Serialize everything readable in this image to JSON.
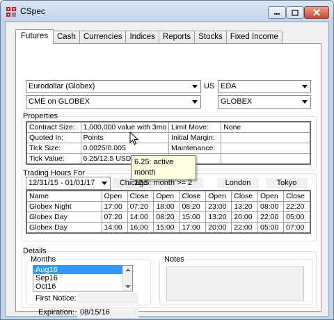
{
  "window": {
    "title": "CSpec"
  },
  "tabs": [
    "Futures",
    "Cash",
    "Currencies",
    "Indices",
    "Reports",
    "Stocks",
    "Fixed Income"
  ],
  "selectors": {
    "contract": "Eurodollar (Globex)",
    "exchange": "CME on GLOBEX",
    "country_label": "US",
    "symbol": "EDA",
    "venue": "GLOBEX"
  },
  "properties": {
    "title": "Properties",
    "rows": [
      {
        "label": "Contract Size:",
        "value": "1,000,000 value with 3mo",
        "label2": "Limit Move:",
        "value2": "None"
      },
      {
        "label": "Quoted In:",
        "value": "Points",
        "label2": "Initial Margin:",
        "value2": ""
      },
      {
        "label": "Tick Size:",
        "value": "0.0025/0.005",
        "label2": "Maintenance:",
        "value2": ""
      },
      {
        "label": "Tick Value:",
        "value": "6.25/12.5 USD",
        "label2": "",
        "value2": ""
      }
    ]
  },
  "trading_hours": {
    "title": "Trading Hours For",
    "date_range": "12/31/15 - 01/01/17",
    "timezones": [
      "Chicago",
      "",
      "London",
      "Tokyo"
    ],
    "columns": [
      "Name",
      "Open",
      "Close",
      "Open",
      "Close",
      "Open",
      "Close",
      "Open",
      "Close"
    ],
    "rows": [
      [
        "Globex Night",
        "17:00",
        "07:20",
        "18:00",
        "08:20",
        "23:00",
        "13:20",
        "08:00",
        "22:20"
      ],
      [
        "Globex Day",
        "07:20",
        "14:00",
        "08:20",
        "15:00",
        "13:20",
        "20:00",
        "22:00",
        "05:00"
      ],
      [
        "Globex Day",
        "14:00",
        "16:00",
        "15:00",
        "17:00",
        "20:00",
        "22:00",
        "05:00",
        "07:00"
      ]
    ]
  },
  "tooltip": {
    "line1": "6.25: active month",
    "line2": "12.5: month >= 2"
  },
  "details": {
    "title": "Details",
    "months_title": "Months",
    "months": [
      "Aug16",
      "Sep16",
      "Oct16"
    ],
    "selected_month": "Aug16",
    "first_notice_label": "First Notice:",
    "first_notice_value": "",
    "expiration_label": "Expiration:",
    "expiration_value": "08/15/16",
    "notes_title": "Notes"
  },
  "colors": {
    "selection": "#3399ff",
    "tooltip_bg": "#ffffe1",
    "close_button": "#c74a30"
  }
}
